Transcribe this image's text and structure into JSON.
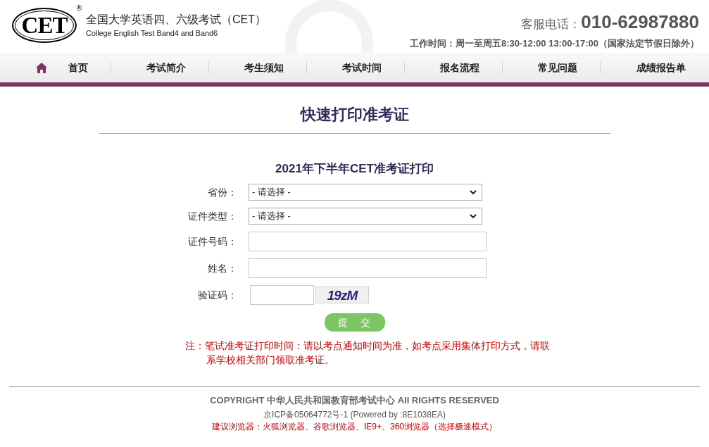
{
  "header": {
    "logo": {
      "text": "CET",
      "mark": "®"
    },
    "title": "全国大学英语四、六级考试（CET）",
    "subtitle": "College English Test Band4 and Band6",
    "phone_label": "客服电话：",
    "phone": "010-62987880",
    "hours": "工作时间：周一至周五8:30-12:00 13:00-17:00（国家法定节假日除外）"
  },
  "nav": {
    "items": [
      {
        "kind": "home",
        "label": "首页"
      },
      {
        "kind": "link",
        "label": "考试简介"
      },
      {
        "kind": "link",
        "label": "考生须知"
      },
      {
        "kind": "link",
        "label": "考试时间"
      },
      {
        "kind": "link",
        "label": "报名流程"
      },
      {
        "kind": "link",
        "label": "常见问题"
      },
      {
        "kind": "link",
        "label": "成绩报告单"
      }
    ]
  },
  "page_title": "快速打印准考证",
  "form": {
    "title": "2021年下半年CET准考证打印",
    "fields": [
      {
        "kind": "select",
        "label": "省份：",
        "value": "- 请选择 -"
      },
      {
        "kind": "select",
        "label": "证件类型：",
        "value": "- 请选择 -"
      },
      {
        "kind": "text",
        "label": "证件号码："
      },
      {
        "kind": "text",
        "label": "姓名："
      },
      {
        "kind": "captcha",
        "label": "验证码：",
        "code": "19zM"
      }
    ],
    "submit": "提　交"
  },
  "note": "注：笔试准考证打印时间：请以考点通知时间为准，如考点采用集体打印方式，请联系学校相关部门领取准考证。",
  "footer": {
    "copyright": "COPYRIGHT 中华人民共和国教育部考试中心 All RIGHTS RESERVED",
    "icp": "京ICP备05064772号-1 (Powered by :8E1038EA)",
    "browsers": "建议浏览器：火狐浏览器、谷歌浏览器、IE9+、360浏览器（选择极速模式）"
  }
}
